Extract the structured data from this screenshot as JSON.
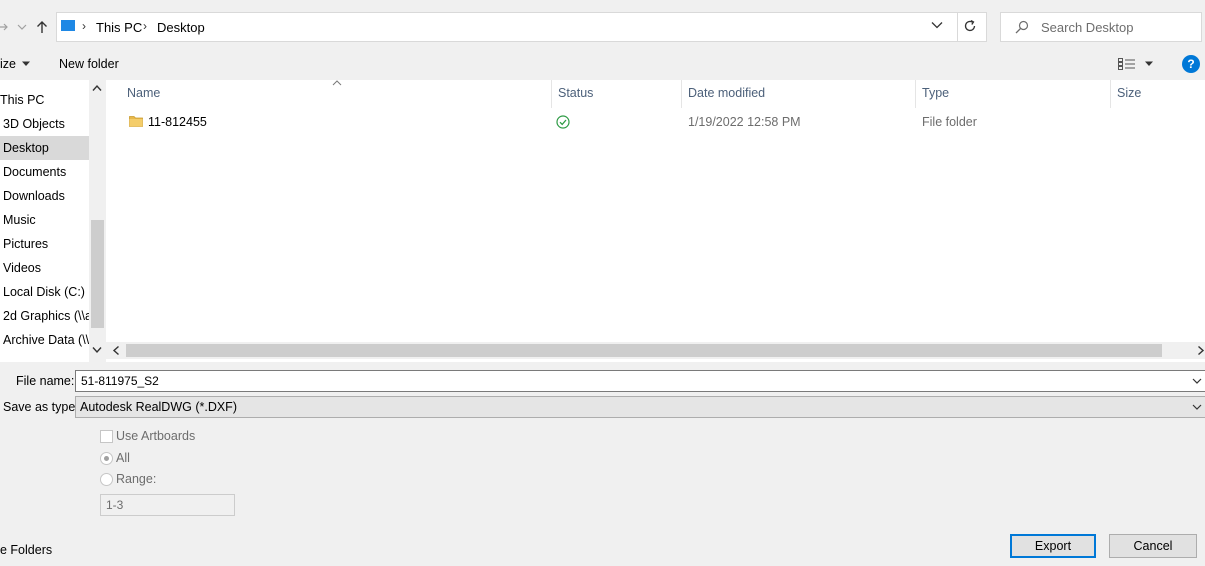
{
  "address": {
    "crumbs": [
      "This PC",
      "Desktop"
    ]
  },
  "search": {
    "placeholder": "Search Desktop"
  },
  "commandbar": {
    "organize_label": "ize",
    "new_folder_label": "New folder"
  },
  "nav": {
    "items": [
      {
        "label": "This PC"
      },
      {
        "label": "3D Objects"
      },
      {
        "label": "Desktop"
      },
      {
        "label": "Documents"
      },
      {
        "label": "Downloads"
      },
      {
        "label": "Music"
      },
      {
        "label": "Pictures"
      },
      {
        "label": "Videos"
      },
      {
        "label": "Local Disk (C:)"
      },
      {
        "label": "2d Graphics (\\\\a"
      },
      {
        "label": "Archive Data (\\\\"
      }
    ],
    "selected": "Desktop"
  },
  "columns": [
    "Name",
    "Status",
    "Date modified",
    "Type",
    "Size"
  ],
  "files": [
    {
      "name": "11-812455",
      "status_icon": "sync-ok-icon",
      "date_modified": "1/19/2022 12:58 PM",
      "type": "File folder",
      "size": ""
    }
  ],
  "form": {
    "file_name_label": "File name:",
    "file_name_value": "51-811975_S2",
    "save_type_label": "Save as type:",
    "save_type_value": "Autodesk RealDWG (*.DXF)"
  },
  "options": {
    "use_artboards_label": "Use Artboards",
    "use_artboards_checked": false,
    "all_label": "All",
    "all_selected": true,
    "range_label": "Range:",
    "range_value": "1-3"
  },
  "footer": {
    "hide_folders_label": "e Folders",
    "export_label": "Export",
    "cancel_label": "Cancel"
  },
  "colors": {
    "accent": "#0078d7",
    "selected_bg": "#d9d9d9",
    "folder": "#e8b84a",
    "status_ok": "#2e9b45"
  }
}
